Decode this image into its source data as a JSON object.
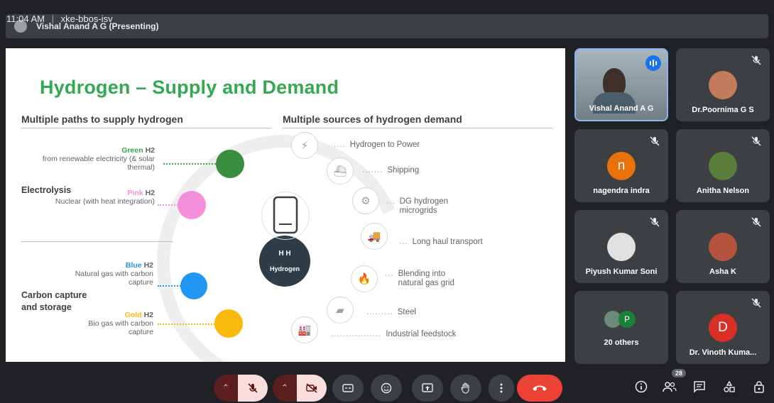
{
  "presenter_bar": {
    "label": "Vishal Anand A G (Presenting)"
  },
  "slide": {
    "title": "Hydrogen – Supply and Demand",
    "left_heading": "Multiple paths to supply hydrogen",
    "right_heading": "Multiple sources of hydrogen demand",
    "groups": {
      "electrolysis": "Electrolysis",
      "carbon_capture": "Carbon capture and storage"
    },
    "supply": [
      {
        "color_word": "Green",
        "suffix": " H2",
        "desc": "from renewable electricity (& solar thermal)",
        "color": "#34a853"
      },
      {
        "color_word": "Pink",
        "suffix": " H2",
        "desc": "Nuclear (with heat integration)",
        "color": "#f48fd9"
      },
      {
        "color_word": "Blue",
        "suffix": " H2",
        "desc": "Natural gas with carbon capture",
        "color": "#2196f3"
      },
      {
        "color_word": "Gold",
        "suffix": " H2",
        "desc": "Bio gas with carbon capture",
        "color": "#f9b90b"
      }
    ],
    "center_label": "Hydrogen",
    "center_glyph": "H H",
    "demand": [
      {
        "label": "Hydrogen to Power",
        "icon": "power-icon"
      },
      {
        "label": "Shipping",
        "icon": "ship-icon"
      },
      {
        "label": "DG hydrogen microgrids",
        "icon": "generator-icon"
      },
      {
        "label": "Long haul transport",
        "icon": "truck-icon"
      },
      {
        "label": "Blending into natural gas grid",
        "icon": "flame-icon"
      },
      {
        "label": "Steel",
        "icon": "steel-icon"
      },
      {
        "label": "Industrial feedstock",
        "icon": "factory-icon"
      }
    ]
  },
  "participants": [
    {
      "name": "Vishal Anand A G",
      "speaking": true
    },
    {
      "name": "Dr.Poornima G S",
      "avatar_type": "photo",
      "avatar_color": "#c27c5c"
    },
    {
      "name": "nagendra indra",
      "avatar_type": "letter",
      "initial": "n",
      "avatar_color": "#e8710a"
    },
    {
      "name": "Anitha Nelson",
      "avatar_type": "photo",
      "avatar_color": "#5a7d3c"
    },
    {
      "name": "Piyush Kumar Soni",
      "avatar_type": "photo",
      "avatar_color": "#e0e0e0"
    },
    {
      "name": "Asha K",
      "avatar_type": "photo",
      "avatar_color": "#b5533e"
    },
    {
      "name": "20 others",
      "avatar_type": "group",
      "group_initial": "P",
      "avatar_color": "#188038"
    },
    {
      "name": "Dr. Vinoth Kuma...",
      "avatar_type": "letter",
      "initial": "D",
      "avatar_color": "#d93025"
    }
  ],
  "bottom": {
    "time": "11:04 AM",
    "separator": "|",
    "meeting_code": "xke-bbos-isv",
    "people_count": "28"
  },
  "colors": {
    "end_call": "#ea4335",
    "accent_title": "#34a853"
  }
}
